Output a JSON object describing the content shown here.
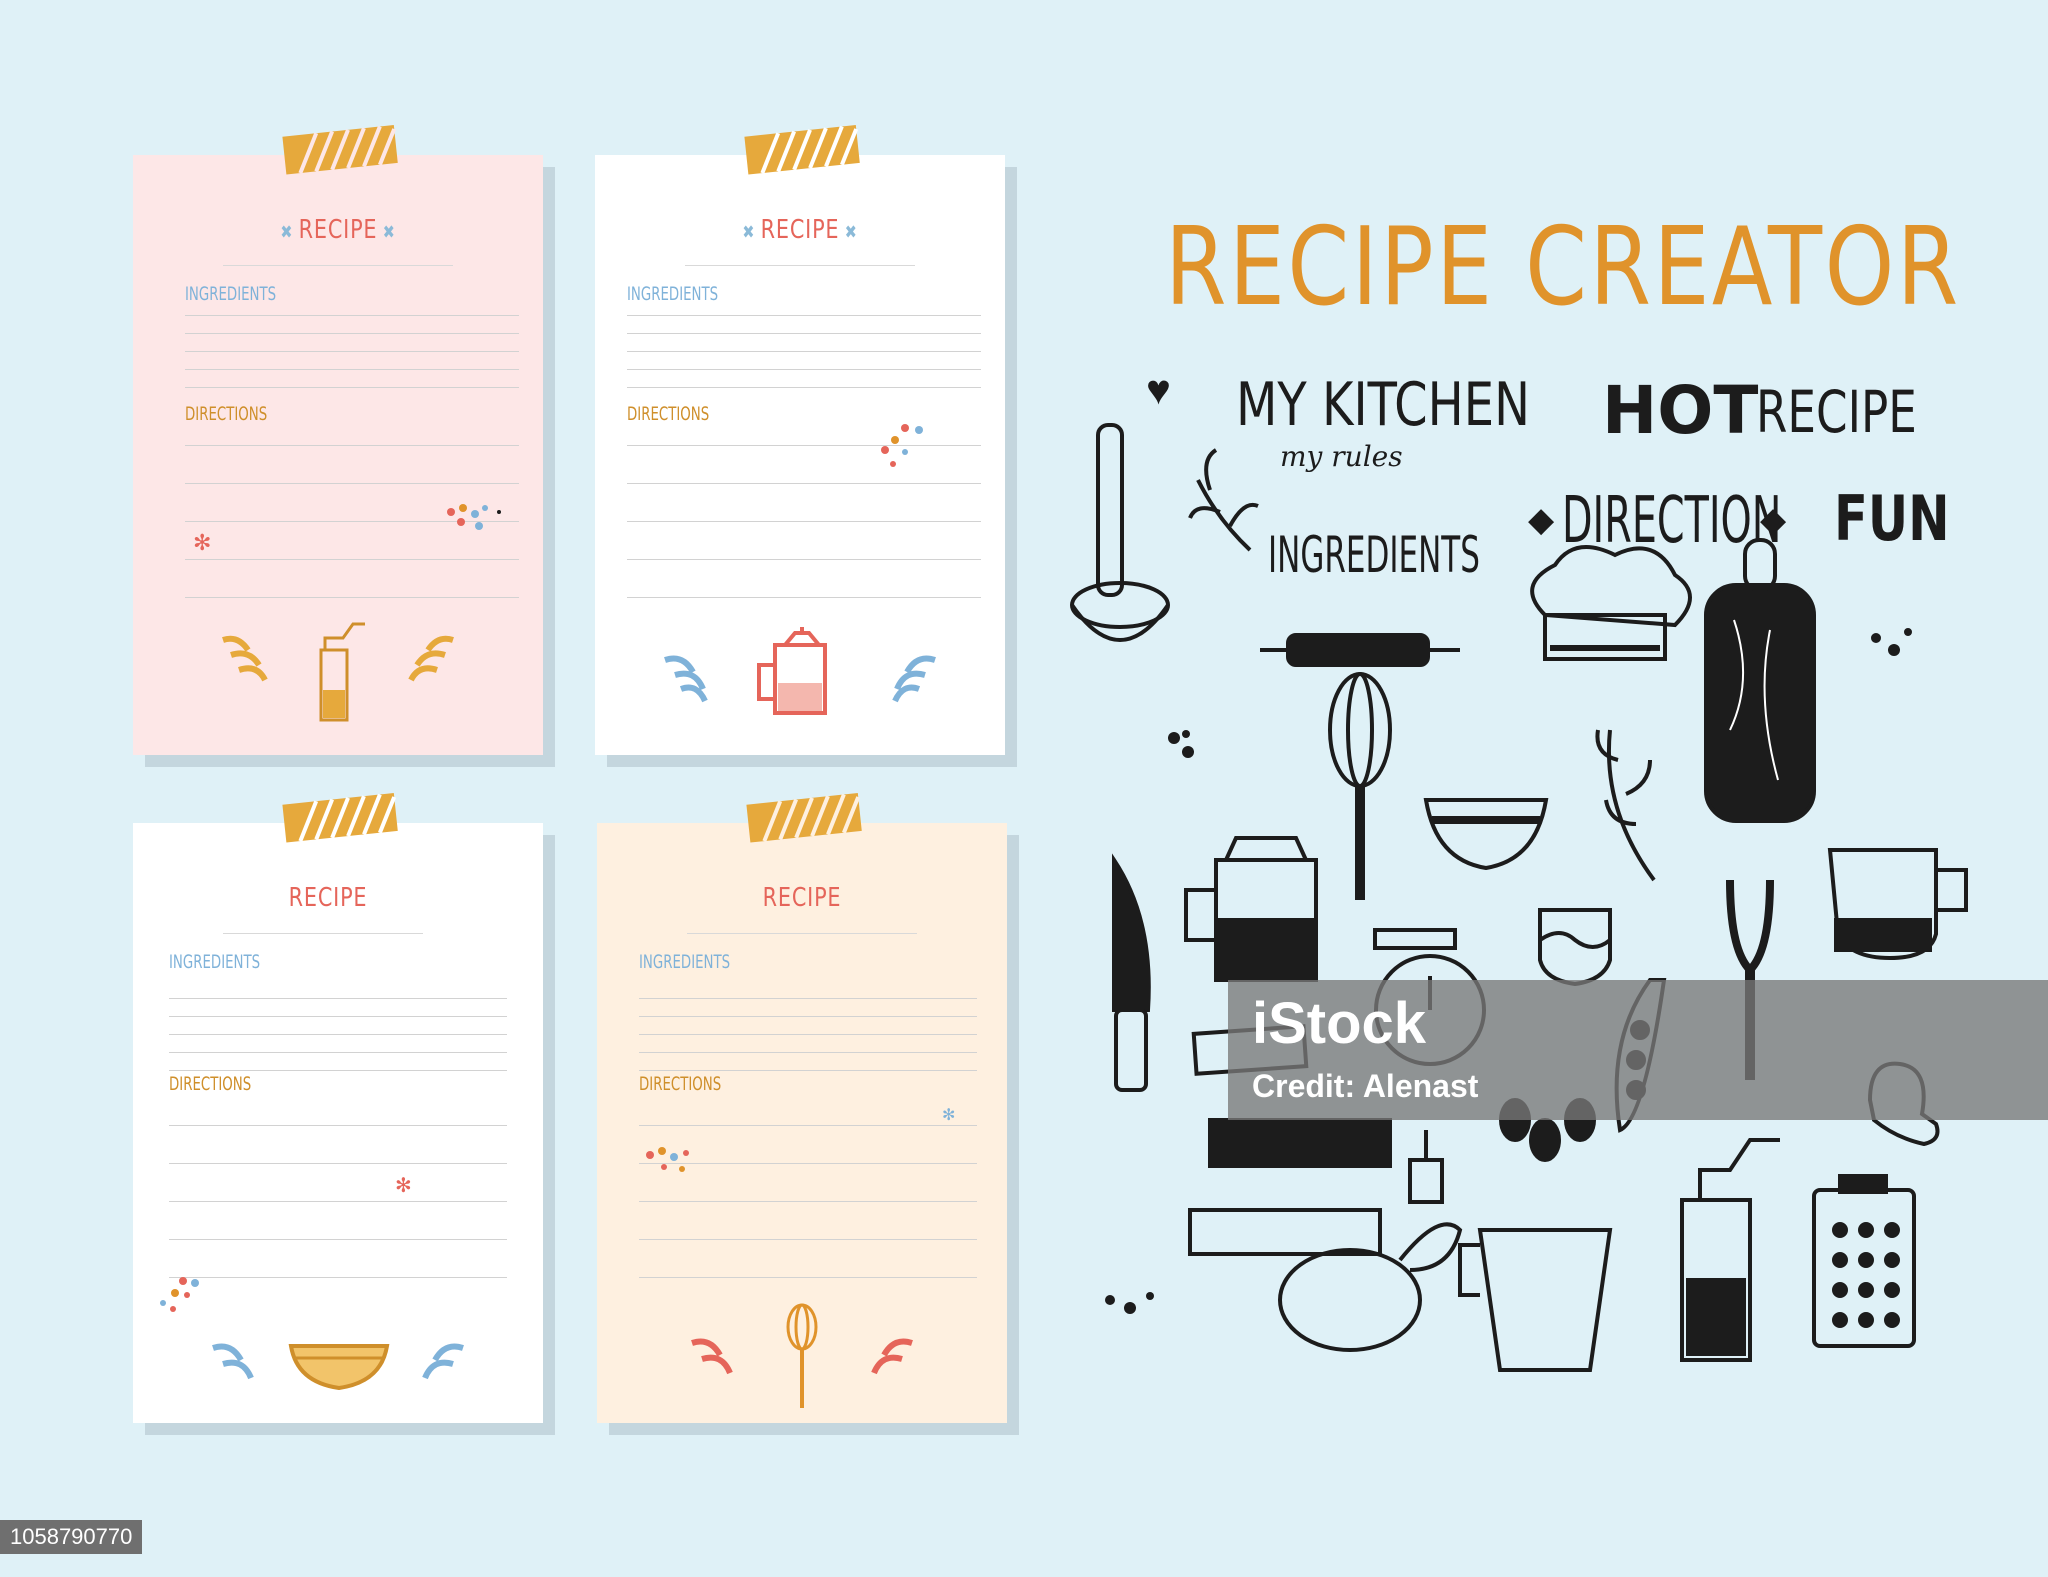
{
  "cards": [
    {
      "title": "RECIPE",
      "ingredients": "INGREDIENTS",
      "directions": "DIRECTIONS",
      "bg": "#fde7e7",
      "deco": "coffee-grinder"
    },
    {
      "title": "RECIPE",
      "ingredients": "INGREDIENTS",
      "directions": "DIRECTIONS",
      "bg": "#ffffff",
      "deco": "french-press"
    },
    {
      "title": "RECIPE",
      "ingredients": "INGREDIENTS",
      "directions": "DIRECTIONS",
      "bg": "#ffffff",
      "deco": "bowl"
    },
    {
      "title": "RECIPE",
      "ingredients": "INGREDIENTS",
      "directions": "DIRECTIONS",
      "bg": "#fef0e0",
      "deco": "whisk"
    }
  ],
  "headline": "RECIPE CREATOR",
  "words": {
    "my_kitchen": "MY KITCHEN",
    "my_rules": "my rules",
    "hot": "HOT",
    "recipe": "RECIPE",
    "direction": "DIRECTION",
    "fun": "FUN",
    "ingredients": "INGREDIENTS"
  },
  "watermark": {
    "brand": "iStock",
    "credit": "Credit: Alenast"
  },
  "image_id": "1058790770",
  "colors": {
    "background": "#dff1f7",
    "accent_orange": "#e0932b",
    "accent_red": "#e5655a",
    "accent_blue": "#7fb2d9"
  }
}
